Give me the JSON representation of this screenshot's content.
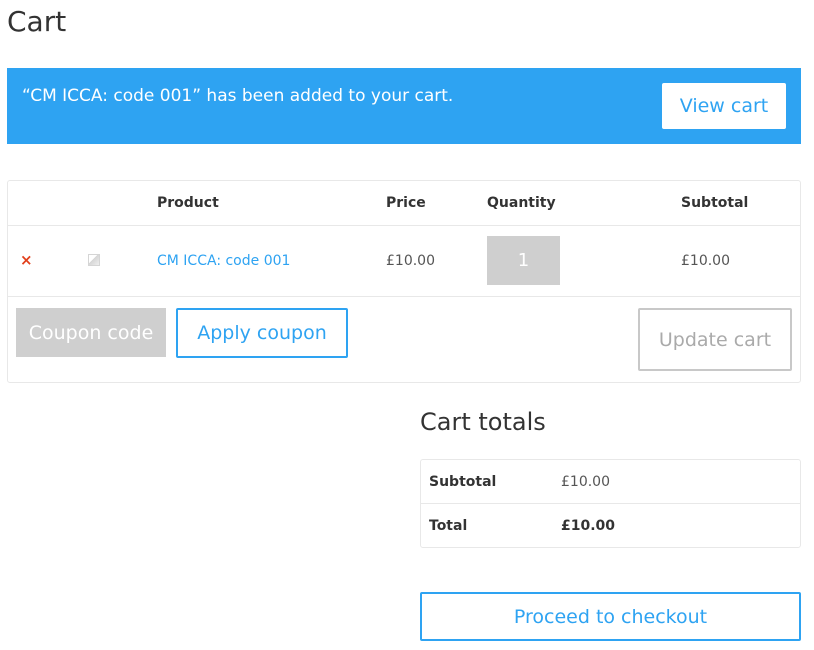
{
  "page": {
    "title": "Cart"
  },
  "notice": {
    "message": "“CM ICCA: code 001” has been added to your cart.",
    "view_cart_label": "View cart",
    "background_color": "#2ea3f2"
  },
  "cart_table": {
    "headers": {
      "product": "Product",
      "price": "Price",
      "quantity": "Quantity",
      "subtotal": "Subtotal"
    },
    "items": [
      {
        "remove_icon": "remove-x-icon",
        "thumbnail_icon": "image-placeholder-icon",
        "product": "CM ICCA: code 001",
        "price": "£10.00",
        "quantity": "1",
        "subtotal": "£10.00"
      }
    ],
    "coupon_placeholder": "Coupon code",
    "apply_coupon_label": "Apply coupon",
    "update_cart_label": "Update cart"
  },
  "cart_totals": {
    "title": "Cart totals",
    "subtotal_label": "Subtotal",
    "subtotal_value": "£10.00",
    "total_label": "Total",
    "total_value": "£10.00"
  },
  "checkout": {
    "label": "Proceed to checkout"
  },
  "colors": {
    "accent": "#2ea3f2",
    "remove": "#e2401c"
  }
}
